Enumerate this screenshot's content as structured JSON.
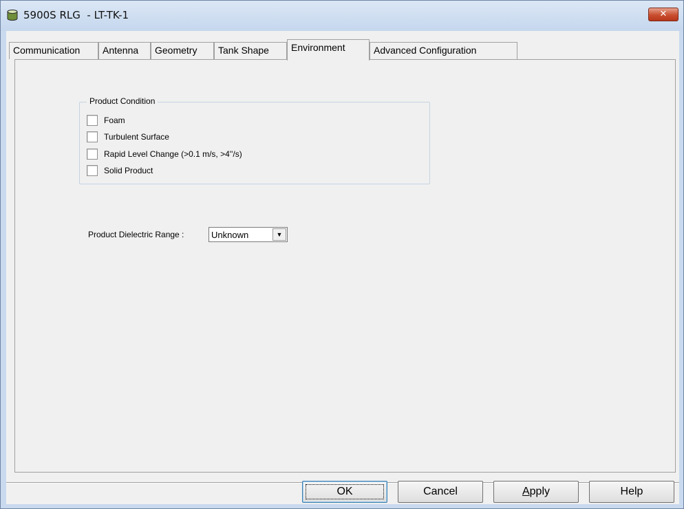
{
  "window": {
    "title": "5900S RLG  - LT-TK-1",
    "close_label": "✕"
  },
  "tabs": [
    {
      "label": "Communication"
    },
    {
      "label": "Antenna"
    },
    {
      "label": "Geometry"
    },
    {
      "label": "Tank Shape"
    },
    {
      "label": "Environment",
      "active": true
    },
    {
      "label": "Advanced Configuration"
    }
  ],
  "product_condition": {
    "title": "Product Condition",
    "options": [
      {
        "label": "Foam",
        "checked": false
      },
      {
        "label": "Turbulent Surface",
        "checked": false
      },
      {
        "label": "Rapid Level Change (>0.1 m/s, >4''/s)",
        "checked": false
      },
      {
        "label": "Solid Product",
        "checked": false
      }
    ]
  },
  "dielectric": {
    "label": "Product Dielectric Range :",
    "value": "Unknown",
    "arrow": "▼"
  },
  "buttons": {
    "ok": "OK",
    "cancel": "Cancel",
    "apply_mnemonic": "A",
    "apply_rest": "pply",
    "help": "Help"
  }
}
